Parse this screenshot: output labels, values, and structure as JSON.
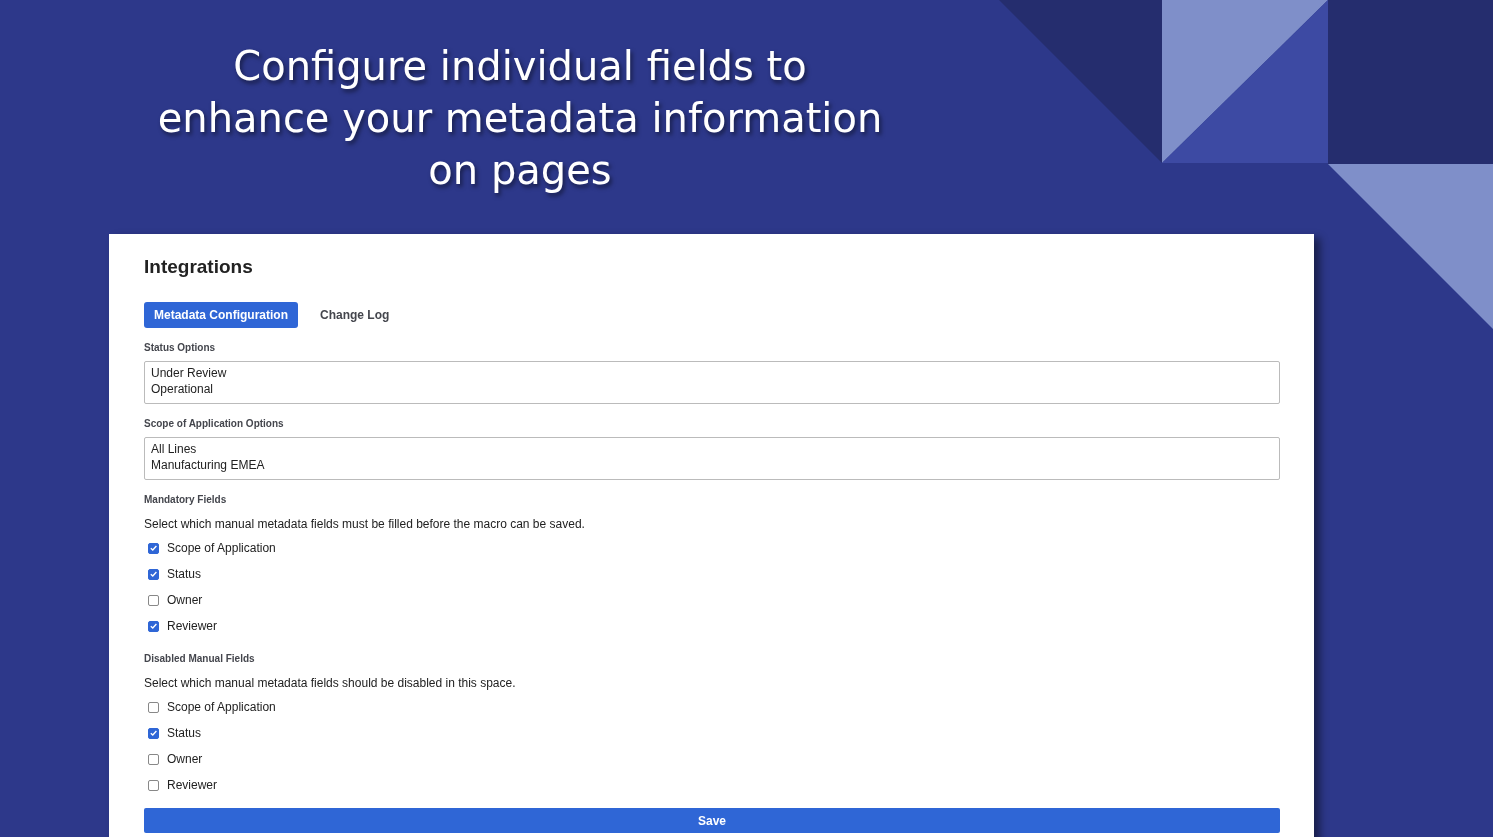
{
  "headline": "Configure individual fields to enhance your metadata information on pages",
  "panel": {
    "title": "Integrations",
    "tabs": [
      {
        "label": "Metadata Configuration",
        "selected": true
      },
      {
        "label": "Change Log",
        "selected": false
      }
    ],
    "option_lists": [
      {
        "label": "Status Options",
        "lines": [
          "Under Review",
          "Operational"
        ]
      },
      {
        "label": "Scope of Application Options",
        "lines": [
          "All Lines",
          "Manufacturing EMEA"
        ]
      }
    ],
    "field_groups": [
      {
        "label": "Mandatory Fields",
        "description": "Select which manual metadata fields must be filled before the macro can be saved.",
        "items": [
          {
            "label": "Scope of Application",
            "checked": true
          },
          {
            "label": "Status",
            "checked": true
          },
          {
            "label": "Owner",
            "checked": false
          },
          {
            "label": "Reviewer",
            "checked": true
          }
        ]
      },
      {
        "label": "Disabled Manual Fields",
        "description": "Select which manual metadata fields should be disabled in this space.",
        "items": [
          {
            "label": "Scope of Application",
            "checked": false
          },
          {
            "label": "Status",
            "checked": true
          },
          {
            "label": "Owner",
            "checked": false
          },
          {
            "label": "Reviewer",
            "checked": false
          }
        ]
      }
    ],
    "save_button": "Save"
  }
}
